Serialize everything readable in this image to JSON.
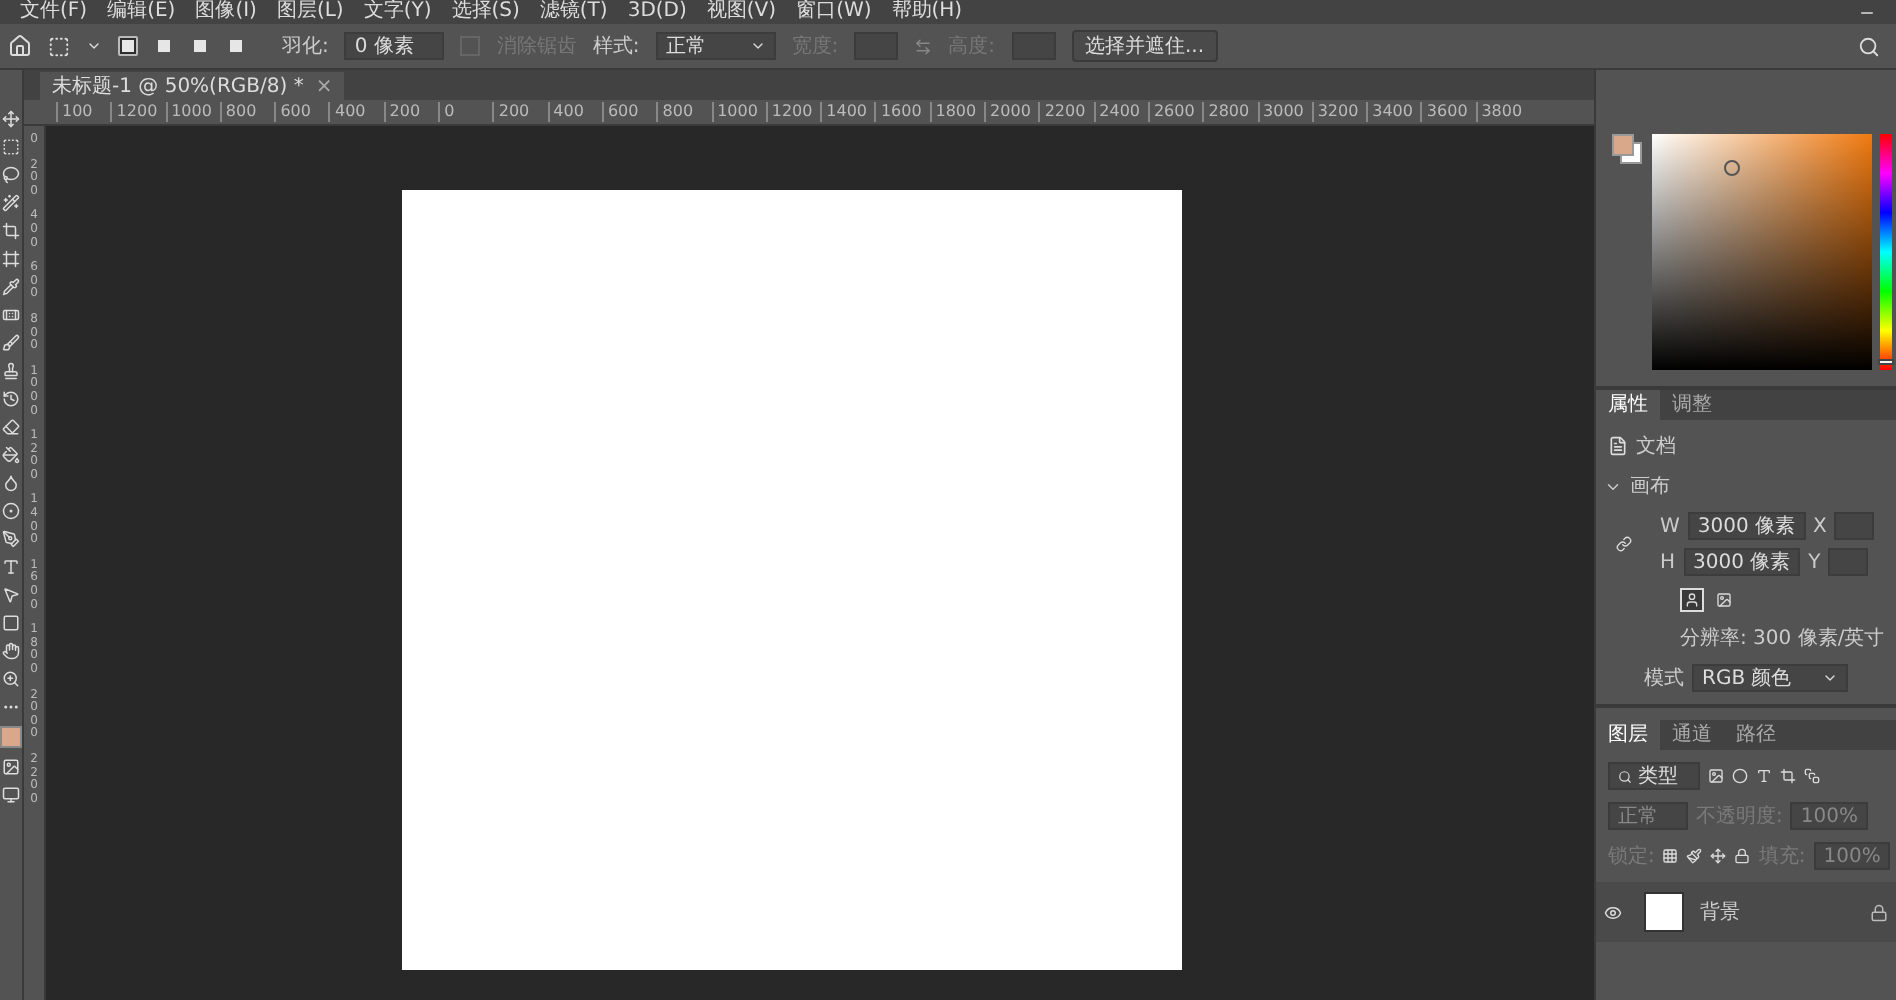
{
  "menu": [
    {
      "label": "文件(F)"
    },
    {
      "label": "编辑(E)"
    },
    {
      "label": "图像(I)"
    },
    {
      "label": "图层(L)"
    },
    {
      "label": "文字(Y)"
    },
    {
      "label": "选择(S)"
    },
    {
      "label": "滤镜(T)"
    },
    {
      "label": "3D(D)"
    },
    {
      "label": "视图(V)"
    },
    {
      "label": "窗口(W)"
    },
    {
      "label": "帮助(H)"
    }
  ],
  "options": {
    "selection_modes": [
      {
        "selected": true
      },
      {
        "selected": false
      },
      {
        "selected": false
      },
      {
        "selected": false
      }
    ],
    "feather_label": "羽化:",
    "feather_value": "0 像素",
    "antialias": {
      "label": "消除锯齿",
      "disabled": true
    },
    "style_label": "样式:",
    "style_value": "正常",
    "width_label": "宽度:",
    "height_label": "高度:",
    "size_disabled": true,
    "mask_button": "选择并遮住..."
  },
  "color_panel": {
    "hue": {
      "level": 0.03
    }
  },
  "document_tab": {
    "title": "未标题-1 @ 50%(RGB/8) *",
    "close": "×"
  },
  "ruler": {
    "top_labels": [
      "100",
      "1200",
      "1000",
      "800",
      "600",
      "400",
      "200",
      "0",
      "200",
      "400",
      "600",
      "800",
      "1000",
      "1200",
      "1400",
      "1600",
      "1800",
      "2000",
      "2200",
      "2400",
      "2600",
      "2800",
      "3000",
      "3200",
      "3400",
      "3600",
      "3800"
    ],
    "side_labels": [
      "0",
      "200",
      "400",
      "600",
      "800",
      "1000",
      "1200",
      "1400",
      "1600",
      "1800",
      "2000",
      "2200"
    ]
  },
  "properties": {
    "tabs": [
      {
        "label": "属性",
        "selected": true
      },
      {
        "label": "调整",
        "selected": false
      }
    ],
    "document_label": "文档",
    "canvas_section": {
      "title": "画布",
      "expanded": true
    },
    "width": {
      "label": "W",
      "value": "3000 像素"
    },
    "height": {
      "label": "H",
      "value": "3000 像素"
    },
    "x_label": "X",
    "y_label": "Y",
    "orientation": [
      {
        "selected": true
      },
      {
        "selected": false
      }
    ],
    "resolution": "分辨率: 300 像素/英寸",
    "mode_label": "模式",
    "mode_value": "RGB 颜色"
  },
  "layers_panel": {
    "tabs": [
      {
        "label": "图层",
        "selected": true
      },
      {
        "label": "通道",
        "selected": false
      },
      {
        "label": "路径",
        "selected": false
      }
    ],
    "filter_placeholder": "类型",
    "blend_mode": "正常",
    "opacity_label": "不透明度:",
    "opacity": "100%",
    "lock_label": "锁定:",
    "fill_label": "填充:",
    "fill": "100%",
    "controls_disabled": true,
    "layers": [
      {
        "name": "背景",
        "visible": true,
        "locked": true
      }
    ]
  }
}
